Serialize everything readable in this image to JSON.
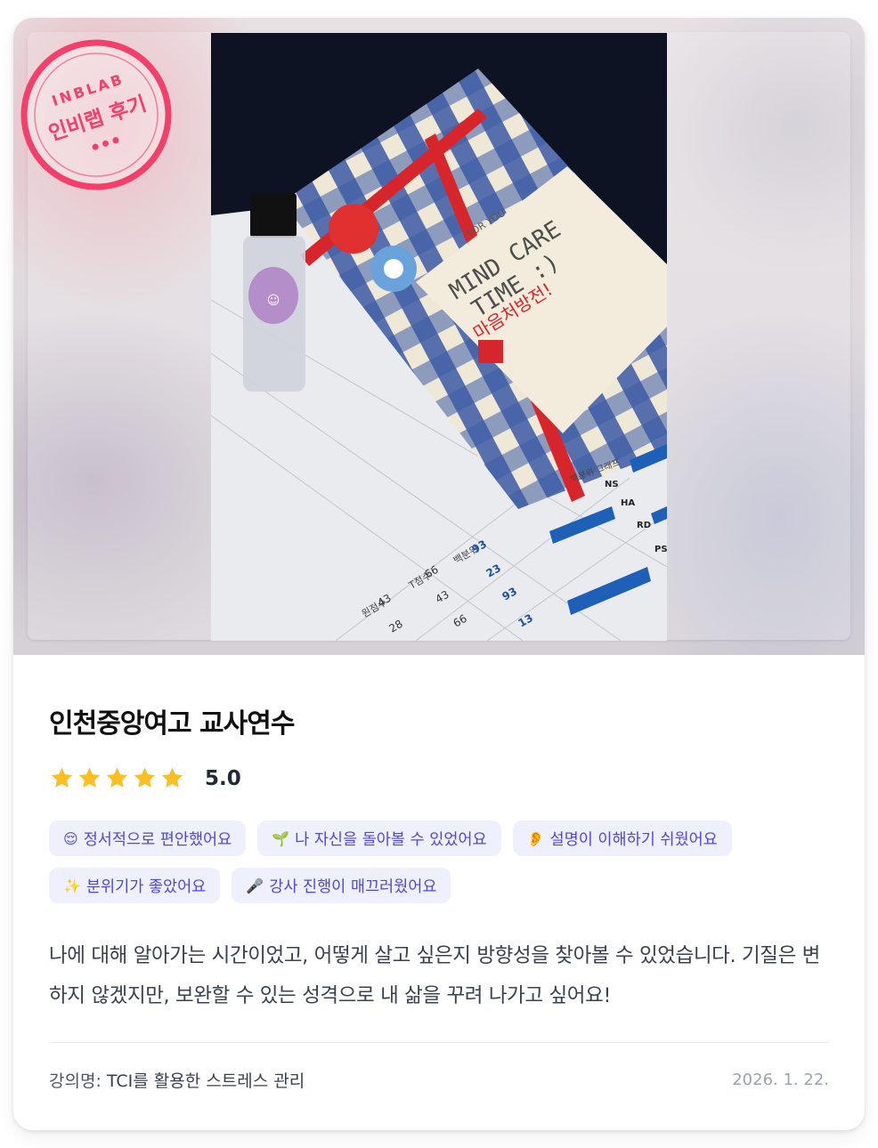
{
  "stamp": {
    "top_text": "INBLAB",
    "main_text": "인비랩 후기",
    "color": "#f43f6b"
  },
  "review": {
    "title": "인천중앙여고 교사연수",
    "rating": 5,
    "rating_label": "5.0",
    "star_color": "#fbbf24",
    "tags": [
      {
        "icon": "relieved-face-icon",
        "emoji": "😌",
        "label": "정서적으로 편안했어요"
      },
      {
        "icon": "seedling-icon",
        "emoji": "🌱",
        "label": "나 자신을 돌아볼 수 있었어요"
      },
      {
        "icon": "ear-icon",
        "emoji": "👂",
        "label": "설명이 이해하기 쉬웠어요"
      },
      {
        "icon": "sparkles-icon",
        "emoji": "✨",
        "label": "분위기가 좋았어요"
      },
      {
        "icon": "microphone-icon",
        "emoji": "🎤",
        "label": "강사 진행이 매끄러웠어요"
      }
    ],
    "text": "나에 대해 알아가는 시간이었고, 어떻게 살고 싶은지 방향성을 찾아볼 수 있었습니다. 기질은 변하지 않겠지만, 보완할 수 있는 성격으로 내 삶을 꾸려 나가고 싶어요!",
    "lecture_label": "강의명:",
    "lecture_name": "TCI를 활용한 스트레스 관리",
    "date": "2026. 1. 22."
  },
  "photo": {
    "card_lines": [
      "FOR YOU",
      "MIND CARE",
      "TIME :)",
      "마음처방전!"
    ],
    "table_headers": [
      "원점수",
      "T점수",
      "백분위"
    ],
    "table_rows": [
      [
        "43",
        "66",
        "93"
      ],
      [
        "43",
        "",
        "23"
      ],
      [
        "28",
        "66",
        "93"
      ],
      [
        "",
        "",
        "13"
      ]
    ],
    "graph_title": "백분위 그래프",
    "graph_labels": [
      "NS",
      "HA",
      "RD",
      "PS"
    ]
  }
}
